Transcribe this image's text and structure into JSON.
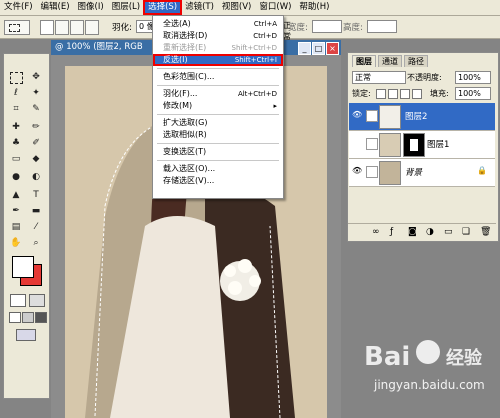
{
  "menubar": {
    "items": [
      "文件(F)",
      "编辑(E)",
      "图像(I)",
      "图层(L)",
      "选择(S)",
      "滤镜(T)",
      "视图(V)",
      "窗口(W)",
      "帮助(H)"
    ]
  },
  "options": {
    "feather_label": "羽化:",
    "feather_value": "0 像",
    "width_label": "宽度:",
    "height_label": "高度:",
    "style_value": "正常"
  },
  "document": {
    "title": "@ 100% (图层2, RGB"
  },
  "select_menu": {
    "items": [
      {
        "label": "全选(A)",
        "shortcut": "Ctrl+A"
      },
      {
        "label": "取消选择(D)",
        "shortcut": "Ctrl+D"
      },
      {
        "label": "重新选择(E)",
        "shortcut": "Shift+Ctrl+D"
      },
      {
        "label": "反选(I)",
        "shortcut": "Shift+Ctrl+I"
      },
      {
        "label": "色彩范围(C)...",
        "shortcut": ""
      },
      {
        "label": "羽化(F)...",
        "shortcut": "Alt+Ctrl+D"
      },
      {
        "label": "修改(M)",
        "shortcut": ""
      },
      {
        "label": "扩大选取(G)",
        "shortcut": ""
      },
      {
        "label": "选取相似(R)",
        "shortcut": ""
      },
      {
        "label": "变换选区(T)",
        "shortcut": ""
      },
      {
        "label": "载入选区(O)...",
        "shortcut": ""
      },
      {
        "label": "存储选区(V)...",
        "shortcut": ""
      }
    ]
  },
  "layers_panel": {
    "tabs": [
      "图层",
      "通道",
      "路径"
    ],
    "blend_mode": "正常",
    "opacity_label": "不透明度:",
    "opacity_value": "100%",
    "lock_label": "锁定:",
    "fill_label": "填充:",
    "fill_value": "100%",
    "layers": [
      {
        "name": "图层2",
        "selected": true
      },
      {
        "name": "图层1",
        "selected": false
      },
      {
        "name": "背景",
        "selected": false
      }
    ]
  },
  "watermark": {
    "brand": "Bai",
    "brand_suffix": "经验",
    "url": "jingyan.baidu.com"
  },
  "colors": {
    "accent": "#316ac5",
    "highlight_border": "#e00000",
    "background_swatch": "#e53935",
    "foreground_swatch": "#ffffff"
  }
}
